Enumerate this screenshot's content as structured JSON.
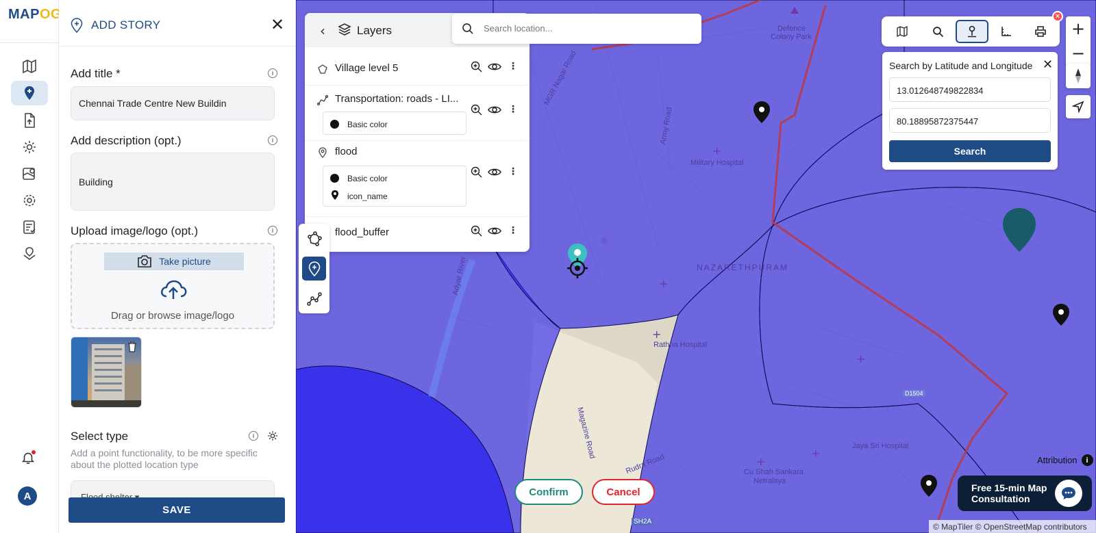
{
  "app": {
    "logo_main": "MAP",
    "logo_accent": "OG"
  },
  "rail": {
    "icons": [
      "map-icon",
      "add-story-icon",
      "upload-icon",
      "settings-gear-icon",
      "analysis-icon",
      "options-icon",
      "report-icon",
      "location-layers-icon"
    ],
    "avatar_initial": "A"
  },
  "panel": {
    "title": "ADD STORY",
    "title_label": "Add title *",
    "title_value": "Chennai Trade Centre New Buildin",
    "description_label": "Add description (opt.)",
    "description_value": "Building",
    "upload_label": "Upload image/logo (opt.)",
    "take_picture": "Take picture",
    "drag_text": "Drag or browse image/logo",
    "select_type_label": "Select type",
    "select_type_help": "Add a point functionality, to be more specific about the plotted location type",
    "select_type_value": "Flood shelter ▾",
    "save": "SAVE"
  },
  "layers": {
    "title": "Layers",
    "items": [
      {
        "name": "Village level 5",
        "legend": []
      },
      {
        "name": "Transportation: roads - LI...",
        "legend": [
          "Basic color"
        ]
      },
      {
        "name": "flood",
        "legend": [
          "Basic color",
          "icon_name"
        ]
      },
      {
        "name": "flood_buffer",
        "legend": []
      }
    ]
  },
  "search": {
    "placeholder": "Search location..."
  },
  "latlng": {
    "title": "Search by Latitude and Longitude",
    "lat": "13.012648749822834",
    "lng": "80.18895872375447",
    "button": "Search"
  },
  "map": {
    "labels": {
      "defence": "Defence",
      "colony_park": "Colony Park",
      "military_hospital": "Military Hospital",
      "mgr_nagar_road": "MGR Nagar Road",
      "army_road": "Army Road",
      "nazarethpuram": "NAZARETHPURAM",
      "rathna_hospital": "Rathna Hospital",
      "adyar_river": "Adyar River",
      "magazine_road": "Magazine Road",
      "rudra_road": "Rudra Road",
      "cu_shah_1": "Cu Shah Sankara",
      "cu_shah_2": "Netralaya",
      "jaya_sri": "Jaya Sri Hospital",
      "road_code": "D1504",
      "sh2a": "SH2A"
    },
    "colors": {
      "buffer": "#2a20ee",
      "boundary": "#c0363e",
      "accent": "#1e4b86"
    }
  },
  "actions": {
    "confirm": "Confirm",
    "cancel": "Cancel"
  },
  "footer": {
    "attribution": "Attribution",
    "consult_line1": "Free 15-min Map",
    "consult_line2": "Consultation",
    "credits": "© MapTiler © OpenStreetMap contributors"
  }
}
